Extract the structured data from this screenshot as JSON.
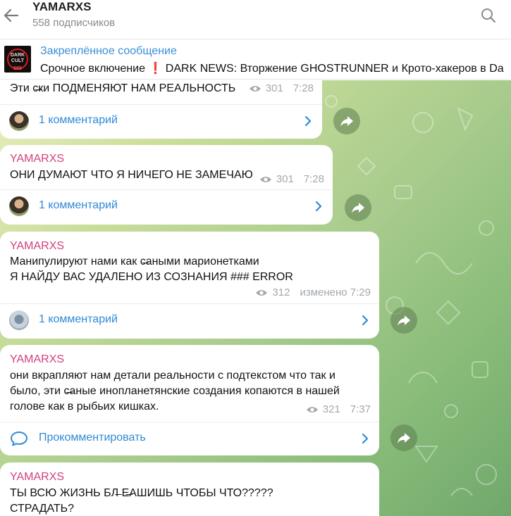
{
  "header": {
    "title": "YAMARXS",
    "subtitle": "558 подписчиков"
  },
  "pinned": {
    "title": "Закреплённое сообщение",
    "text_before": "Срочное включение ",
    "bang": "❗",
    "text_after": " DARK NEWS:  Вторжение GHOSTRUNNER и  Крото-хакеров в Da",
    "thumb_line1": "DARK",
    "thumb_line2": "CULT",
    "thumb_line3": "666"
  },
  "messages": [
    {
      "author": "",
      "text": "Эти с̶ки ПОДМЕНЯЮТ НАМ РЕАЛЬНОСТЬ",
      "views": "301",
      "time": "7:28",
      "comment_label": "1 комментарий"
    },
    {
      "author": "YAMARXS",
      "text": "ОНИ ДУМАЮТ ЧТО Я НИЧЕГО НЕ ЗАМЕЧАЮ",
      "views": "301",
      "time": "7:28",
      "comment_label": "1 комментарий"
    },
    {
      "author": "YAMARXS",
      "line1": "Манипулируют нами как с̶аными марионетками",
      "line2": "Я НАЙДУ ВАС УДАЛЕНО ИЗ СОЗНАНИЯ ### ERROR",
      "views": "312",
      "time": "изменено 7:29",
      "comment_label": "1 комментарий"
    },
    {
      "author": "YAMARXS",
      "line1": "они вкрапляют нам детали реальности с подтекстом что так и",
      "line2": "было, эти с̶аные инопланетянские создания копаются в нашей",
      "line3": "голове как в рыбьих кишках.",
      "views": "321",
      "time": "7:37",
      "comment_label": "Прокомментировать"
    },
    {
      "author": "YAMARXS",
      "line1": "ТЫ ВСЮ ЖИЗНЬ БЛ̶ Е̶АШИШЬ ЧТОБЫ ЧТО?????",
      "line2": "СТРАДАТЬ?"
    }
  ],
  "icons": {
    "back": "arrow-left-icon",
    "search": "search-icon",
    "views": "eye-icon",
    "forward": "share-icon",
    "chevron": "chevron-right-icon",
    "comment": "comment-bubble-icon"
  },
  "colors": {
    "accent": "#3a8fd8",
    "author": "#d2407d",
    "meta": "#a3a8ae",
    "alert": "#e0241b"
  }
}
